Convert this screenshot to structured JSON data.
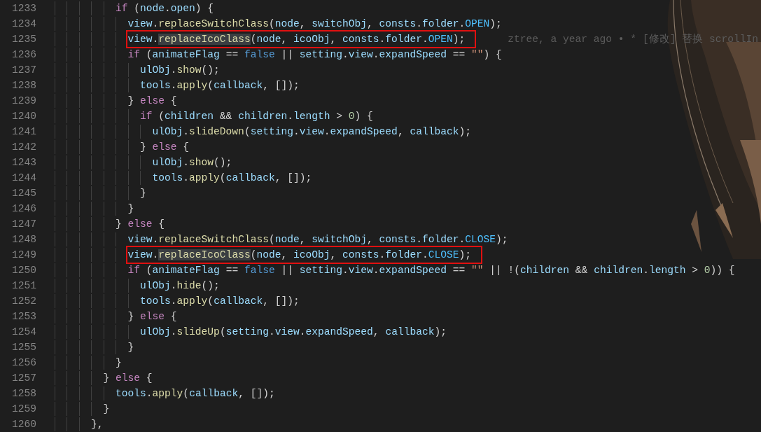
{
  "editor": {
    "lines": [
      {
        "number": "1233",
        "boxed": false,
        "tokens": [
          {
            "kind": "keyword",
            "text": "            if"
          },
          {
            "kind": "plain",
            "text": " ("
          },
          {
            "kind": "variable",
            "text": "node"
          },
          {
            "kind": "plain",
            "text": "."
          },
          {
            "kind": "variable",
            "text": "open"
          },
          {
            "kind": "plain",
            "text": ") {"
          }
        ]
      },
      {
        "number": "1234",
        "boxed": false,
        "tokens": [
          {
            "kind": "variable",
            "text": "              view"
          },
          {
            "kind": "plain",
            "text": "."
          },
          {
            "kind": "function",
            "text": "replaceSwitchClass"
          },
          {
            "kind": "plain",
            "text": "("
          },
          {
            "kind": "variable",
            "text": "node"
          },
          {
            "kind": "plain",
            "text": ", "
          },
          {
            "kind": "variable",
            "text": "switchObj"
          },
          {
            "kind": "plain",
            "text": ", "
          },
          {
            "kind": "variable",
            "text": "consts"
          },
          {
            "kind": "plain",
            "text": "."
          },
          {
            "kind": "variable",
            "text": "folder"
          },
          {
            "kind": "plain",
            "text": "."
          },
          {
            "kind": "constant",
            "text": "OPEN"
          },
          {
            "kind": "plain",
            "text": ");"
          }
        ]
      },
      {
        "number": "1235",
        "boxed": true,
        "blame": "ztree, a year ago • * [修改] 替换 scrollIn",
        "tokens": [
          {
            "kind": "variable",
            "text": "              view"
          },
          {
            "kind": "plain",
            "text": "."
          },
          {
            "kind": "match",
            "text": "replaceIcoClass"
          },
          {
            "kind": "plain",
            "text": "("
          },
          {
            "kind": "variable",
            "text": "node"
          },
          {
            "kind": "plain",
            "text": ", "
          },
          {
            "kind": "variable",
            "text": "icoObj"
          },
          {
            "kind": "plain",
            "text": ", "
          },
          {
            "kind": "variable",
            "text": "consts"
          },
          {
            "kind": "plain",
            "text": "."
          },
          {
            "kind": "variable",
            "text": "folder"
          },
          {
            "kind": "plain",
            "text": "."
          },
          {
            "kind": "constant",
            "text": "OPEN"
          },
          {
            "kind": "plain",
            "text": ");"
          }
        ]
      },
      {
        "number": "1236",
        "boxed": false,
        "tokens": [
          {
            "kind": "keyword",
            "text": "              if"
          },
          {
            "kind": "plain",
            "text": " ("
          },
          {
            "kind": "variable",
            "text": "animateFlag"
          },
          {
            "kind": "plain",
            "text": " == "
          },
          {
            "kind": "boolean",
            "text": "false"
          },
          {
            "kind": "plain",
            "text": " || "
          },
          {
            "kind": "variable",
            "text": "setting"
          },
          {
            "kind": "plain",
            "text": "."
          },
          {
            "kind": "variable",
            "text": "view"
          },
          {
            "kind": "plain",
            "text": "."
          },
          {
            "kind": "variable",
            "text": "expandSpeed"
          },
          {
            "kind": "plain",
            "text": " == "
          },
          {
            "kind": "string",
            "text": "\"\""
          },
          {
            "kind": "plain",
            "text": ") {"
          }
        ]
      },
      {
        "number": "1237",
        "boxed": false,
        "tokens": [
          {
            "kind": "variable",
            "text": "                ulObj"
          },
          {
            "kind": "plain",
            "text": "."
          },
          {
            "kind": "function",
            "text": "show"
          },
          {
            "kind": "plain",
            "text": "();"
          }
        ]
      },
      {
        "number": "1238",
        "boxed": false,
        "tokens": [
          {
            "kind": "variable",
            "text": "                tools"
          },
          {
            "kind": "plain",
            "text": "."
          },
          {
            "kind": "function",
            "text": "apply"
          },
          {
            "kind": "plain",
            "text": "("
          },
          {
            "kind": "variable",
            "text": "callback"
          },
          {
            "kind": "plain",
            "text": ", []);"
          }
        ]
      },
      {
        "number": "1239",
        "boxed": false,
        "tokens": [
          {
            "kind": "plain",
            "text": "              } "
          },
          {
            "kind": "keyword",
            "text": "else"
          },
          {
            "kind": "plain",
            "text": " {"
          }
        ]
      },
      {
        "number": "1240",
        "boxed": false,
        "tokens": [
          {
            "kind": "keyword",
            "text": "                if"
          },
          {
            "kind": "plain",
            "text": " ("
          },
          {
            "kind": "variable",
            "text": "children"
          },
          {
            "kind": "plain",
            "text": " && "
          },
          {
            "kind": "variable",
            "text": "children"
          },
          {
            "kind": "plain",
            "text": "."
          },
          {
            "kind": "variable",
            "text": "length"
          },
          {
            "kind": "plain",
            "text": " > "
          },
          {
            "kind": "number",
            "text": "0"
          },
          {
            "kind": "plain",
            "text": ") {"
          }
        ]
      },
      {
        "number": "1241",
        "boxed": false,
        "tokens": [
          {
            "kind": "variable",
            "text": "                  ulObj"
          },
          {
            "kind": "plain",
            "text": "."
          },
          {
            "kind": "function",
            "text": "slideDown"
          },
          {
            "kind": "plain",
            "text": "("
          },
          {
            "kind": "variable",
            "text": "setting"
          },
          {
            "kind": "plain",
            "text": "."
          },
          {
            "kind": "variable",
            "text": "view"
          },
          {
            "kind": "plain",
            "text": "."
          },
          {
            "kind": "variable",
            "text": "expandSpeed"
          },
          {
            "kind": "plain",
            "text": ", "
          },
          {
            "kind": "variable",
            "text": "callback"
          },
          {
            "kind": "plain",
            "text": ");"
          }
        ]
      },
      {
        "number": "1242",
        "boxed": false,
        "tokens": [
          {
            "kind": "plain",
            "text": "                } "
          },
          {
            "kind": "keyword",
            "text": "else"
          },
          {
            "kind": "plain",
            "text": " {"
          }
        ]
      },
      {
        "number": "1243",
        "boxed": false,
        "tokens": [
          {
            "kind": "variable",
            "text": "                  ulObj"
          },
          {
            "kind": "plain",
            "text": "."
          },
          {
            "kind": "function",
            "text": "show"
          },
          {
            "kind": "plain",
            "text": "();"
          }
        ]
      },
      {
        "number": "1244",
        "boxed": false,
        "tokens": [
          {
            "kind": "variable",
            "text": "                  tools"
          },
          {
            "kind": "plain",
            "text": "."
          },
          {
            "kind": "function",
            "text": "apply"
          },
          {
            "kind": "plain",
            "text": "("
          },
          {
            "kind": "variable",
            "text": "callback"
          },
          {
            "kind": "plain",
            "text": ", []);"
          }
        ]
      },
      {
        "number": "1245",
        "boxed": false,
        "tokens": [
          {
            "kind": "plain",
            "text": "                }"
          }
        ]
      },
      {
        "number": "1246",
        "boxed": false,
        "tokens": [
          {
            "kind": "plain",
            "text": "              }"
          }
        ]
      },
      {
        "number": "1247",
        "boxed": false,
        "tokens": [
          {
            "kind": "plain",
            "text": "            } "
          },
          {
            "kind": "keyword",
            "text": "else"
          },
          {
            "kind": "plain",
            "text": " {"
          }
        ]
      },
      {
        "number": "1248",
        "boxed": false,
        "tokens": [
          {
            "kind": "variable",
            "text": "              view"
          },
          {
            "kind": "plain",
            "text": "."
          },
          {
            "kind": "function",
            "text": "replaceSwitchClass"
          },
          {
            "kind": "plain",
            "text": "("
          },
          {
            "kind": "variable",
            "text": "node"
          },
          {
            "kind": "plain",
            "text": ", "
          },
          {
            "kind": "variable",
            "text": "switchObj"
          },
          {
            "kind": "plain",
            "text": ", "
          },
          {
            "kind": "variable",
            "text": "consts"
          },
          {
            "kind": "plain",
            "text": "."
          },
          {
            "kind": "variable",
            "text": "folder"
          },
          {
            "kind": "plain",
            "text": "."
          },
          {
            "kind": "constant",
            "text": "CLOSE"
          },
          {
            "kind": "plain",
            "text": ");"
          }
        ]
      },
      {
        "number": "1249",
        "boxed": true,
        "tokens": [
          {
            "kind": "variable",
            "text": "              view"
          },
          {
            "kind": "plain",
            "text": "."
          },
          {
            "kind": "match",
            "text": "replaceIcoClass"
          },
          {
            "kind": "plain",
            "text": "("
          },
          {
            "kind": "variable",
            "text": "node"
          },
          {
            "kind": "plain",
            "text": ", "
          },
          {
            "kind": "variable",
            "text": "icoObj"
          },
          {
            "kind": "plain",
            "text": ", "
          },
          {
            "kind": "variable",
            "text": "consts"
          },
          {
            "kind": "plain",
            "text": "."
          },
          {
            "kind": "variable",
            "text": "folder"
          },
          {
            "kind": "plain",
            "text": "."
          },
          {
            "kind": "constant",
            "text": "CLOSE"
          },
          {
            "kind": "plain",
            "text": ");"
          }
        ]
      },
      {
        "number": "1250",
        "boxed": false,
        "tokens": [
          {
            "kind": "keyword",
            "text": "              if"
          },
          {
            "kind": "plain",
            "text": " ("
          },
          {
            "kind": "variable",
            "text": "animateFlag"
          },
          {
            "kind": "plain",
            "text": " == "
          },
          {
            "kind": "boolean",
            "text": "false"
          },
          {
            "kind": "plain",
            "text": " || "
          },
          {
            "kind": "variable",
            "text": "setting"
          },
          {
            "kind": "plain",
            "text": "."
          },
          {
            "kind": "variable",
            "text": "view"
          },
          {
            "kind": "plain",
            "text": "."
          },
          {
            "kind": "variable",
            "text": "expandSpeed"
          },
          {
            "kind": "plain",
            "text": " == "
          },
          {
            "kind": "string",
            "text": "\"\""
          },
          {
            "kind": "plain",
            "text": " || !("
          },
          {
            "kind": "variable",
            "text": "children"
          },
          {
            "kind": "plain",
            "text": " && "
          },
          {
            "kind": "variable",
            "text": "children"
          },
          {
            "kind": "plain",
            "text": "."
          },
          {
            "kind": "variable",
            "text": "length"
          },
          {
            "kind": "plain",
            "text": " > "
          },
          {
            "kind": "number",
            "text": "0"
          },
          {
            "kind": "plain",
            "text": ")) {"
          }
        ]
      },
      {
        "number": "1251",
        "boxed": false,
        "tokens": [
          {
            "kind": "variable",
            "text": "                ulObj"
          },
          {
            "kind": "plain",
            "text": "."
          },
          {
            "kind": "function",
            "text": "hide"
          },
          {
            "kind": "plain",
            "text": "();"
          }
        ]
      },
      {
        "number": "1252",
        "boxed": false,
        "tokens": [
          {
            "kind": "variable",
            "text": "                tools"
          },
          {
            "kind": "plain",
            "text": "."
          },
          {
            "kind": "function",
            "text": "apply"
          },
          {
            "kind": "plain",
            "text": "("
          },
          {
            "kind": "variable",
            "text": "callback"
          },
          {
            "kind": "plain",
            "text": ", []);"
          }
        ]
      },
      {
        "number": "1253",
        "boxed": false,
        "tokens": [
          {
            "kind": "plain",
            "text": "              } "
          },
          {
            "kind": "keyword",
            "text": "else"
          },
          {
            "kind": "plain",
            "text": " {"
          }
        ]
      },
      {
        "number": "1254",
        "boxed": false,
        "tokens": [
          {
            "kind": "variable",
            "text": "                ulObj"
          },
          {
            "kind": "plain",
            "text": "."
          },
          {
            "kind": "function",
            "text": "slideUp"
          },
          {
            "kind": "plain",
            "text": "("
          },
          {
            "kind": "variable",
            "text": "setting"
          },
          {
            "kind": "plain",
            "text": "."
          },
          {
            "kind": "variable",
            "text": "view"
          },
          {
            "kind": "plain",
            "text": "."
          },
          {
            "kind": "variable",
            "text": "expandSpeed"
          },
          {
            "kind": "plain",
            "text": ", "
          },
          {
            "kind": "variable",
            "text": "callback"
          },
          {
            "kind": "plain",
            "text": ");"
          }
        ]
      },
      {
        "number": "1255",
        "boxed": false,
        "tokens": [
          {
            "kind": "plain",
            "text": "              }"
          }
        ]
      },
      {
        "number": "1256",
        "boxed": false,
        "tokens": [
          {
            "kind": "plain",
            "text": "            }"
          }
        ]
      },
      {
        "number": "1257",
        "boxed": false,
        "tokens": [
          {
            "kind": "plain",
            "text": "          } "
          },
          {
            "kind": "keyword",
            "text": "else"
          },
          {
            "kind": "plain",
            "text": " {"
          }
        ]
      },
      {
        "number": "1258",
        "boxed": false,
        "tokens": [
          {
            "kind": "variable",
            "text": "            tools"
          },
          {
            "kind": "plain",
            "text": "."
          },
          {
            "kind": "function",
            "text": "apply"
          },
          {
            "kind": "plain",
            "text": "("
          },
          {
            "kind": "variable",
            "text": "callback"
          },
          {
            "kind": "plain",
            "text": ", []);"
          }
        ]
      },
      {
        "number": "1259",
        "boxed": false,
        "tokens": [
          {
            "kind": "plain",
            "text": "          }"
          }
        ]
      },
      {
        "number": "1260",
        "boxed": false,
        "tokens": [
          {
            "kind": "plain",
            "text": "        },"
          }
        ]
      }
    ]
  }
}
